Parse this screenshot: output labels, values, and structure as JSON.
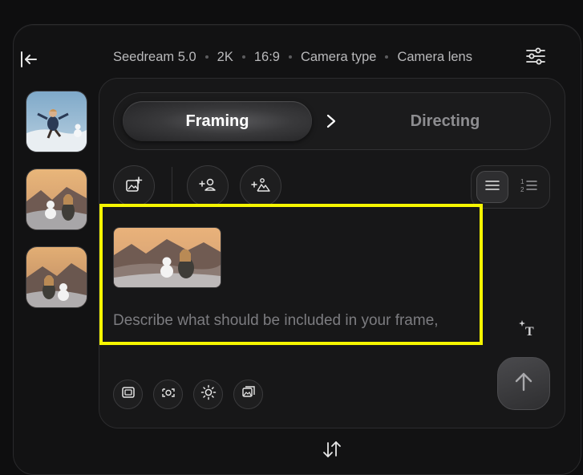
{
  "topbar": {
    "model": "Seedream 5.0",
    "resolution": "2K",
    "aspect_ratio": "16:9",
    "camera_type": "Camera type",
    "camera_lens": "Camera lens"
  },
  "modes": {
    "active": "Framing",
    "inactive": "Directing"
  },
  "prompt": {
    "value": "",
    "placeholder": "Describe what should be included in your frame,"
  },
  "icons": {
    "collapse": "collapse-left-icon",
    "settings": "sliders-icon",
    "add_image": "add-image-icon",
    "add_character": "add-character-icon",
    "add_scene": "add-scene-icon",
    "list_view": "list-view-icon",
    "numbered_view": "numbered-list-icon",
    "text_tool": "text-sparkle-icon",
    "send": "arrow-up-icon",
    "swap": "swap-vertical-icon"
  },
  "colors": {
    "highlight": "#f5f500",
    "background": "#0e0e0f",
    "panel": "#171718"
  }
}
